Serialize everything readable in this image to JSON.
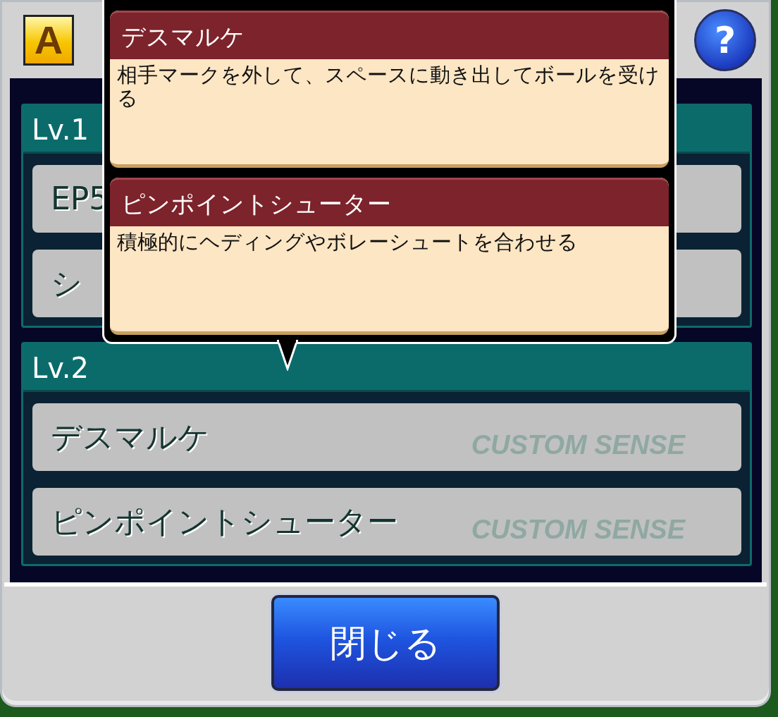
{
  "dialog": {
    "rank_badge": "A",
    "help_button": "?",
    "sections": [
      {
        "label": "Lv.1",
        "items": [
          {
            "name": "EP5"
          },
          {
            "name": "シ"
          }
        ]
      },
      {
        "label": "Lv.2",
        "items": [
          {
            "name": "デスマルケ",
            "tag": "CUSTOM SENSE"
          },
          {
            "name": "ピンポイントシューター",
            "tag": "CUSTOM SENSE"
          }
        ]
      }
    ],
    "close_button": "閉じる"
  },
  "tooltip": {
    "cards": [
      {
        "title": "デスマルケ",
        "description": "相手マークを外して、スペースに動き出してボールを受ける"
      },
      {
        "title": "ピンポイントシューター",
        "description": "積極的にヘディングやボレーシュートを合わせる"
      }
    ]
  }
}
